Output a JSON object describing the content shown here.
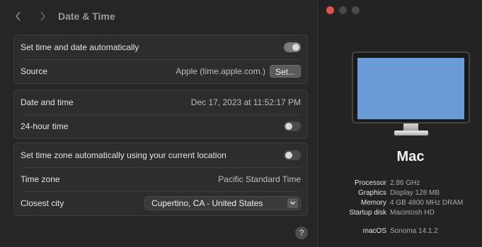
{
  "date_time": {
    "title": "Date & Time",
    "auto_set_label": "Set time and date automatically",
    "auto_set_enabled": true,
    "source_label": "Source",
    "source_value": "Apple (time.apple.com.)",
    "set_button_label": "Set...",
    "date_time_label": "Date and time",
    "date_time_value": "Dec 17, 2023 at 11:52:17 PM",
    "hour24_label": "24-hour time",
    "hour24_enabled": false,
    "auto_timezone_label": "Set time zone automatically using your current location",
    "auto_timezone_enabled": false,
    "timezone_label": "Time zone",
    "timezone_value": "Pacific Standard Time",
    "closest_city_label": "Closest city",
    "closest_city_value": "Cupertino, CA - United States",
    "help_label": "?"
  },
  "about_mac": {
    "name": "Mac",
    "specs": [
      {
        "key": "Processor",
        "value": "2.86 GHz"
      },
      {
        "key": "Graphics",
        "value": "Display 128 MB"
      },
      {
        "key": "Memory",
        "value": "4 GB 4800 MHz DRAM"
      },
      {
        "key": "Startup disk",
        "value": "Macintosh HD"
      }
    ],
    "macos": {
      "key": "macOS",
      "value": "Sonoma 14.1.2"
    }
  },
  "icons": {
    "back": "chevron-left-icon",
    "forward": "chevron-right-icon",
    "select": "chevron-updown-icon",
    "help": "question-icon"
  },
  "colors": {
    "close_button": "#e4534f",
    "screen": "#6b9bd6"
  }
}
